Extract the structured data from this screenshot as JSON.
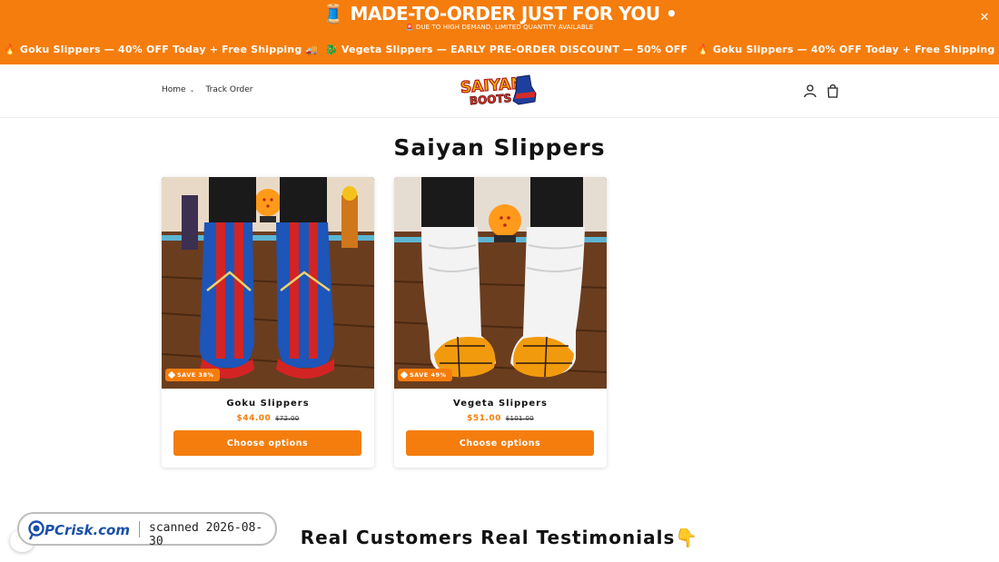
{
  "announcement": {
    "title": "🧵 MADE-TO-ORDER JUST FOR YOU •",
    "subtitle": "🚨 DUE TO HIGH DEMAND, LIMITED QUANTITY AVAILABLE",
    "close_label": "✕",
    "marquee": [
      "🔥 Goku Slippers — 40% OFF Today + Free Shipping 🚚",
      "🐉 Vegeta Slippers — EARLY PRE-ORDER DISCOUNT — 50% OFF",
      "🔥 Goku Slippers — 40% OFF Today + Free Shipping 🚚"
    ]
  },
  "header": {
    "nav": [
      {
        "label": "Home",
        "has_dropdown": true
      },
      {
        "label": "Track Order",
        "has_dropdown": false
      }
    ],
    "logo_text_top": "SAIYAN",
    "logo_text_bottom": "BOOTS",
    "icons": [
      "account-icon",
      "cart-icon"
    ]
  },
  "main": {
    "title": "Saiyan Slippers",
    "products": [
      {
        "name": "Goku Slippers",
        "badge": "SAVE 38%",
        "price": "$44.00",
        "compare_price": "$72.00",
        "button": "Choose options"
      },
      {
        "name": "Vegeta Slippers",
        "badge": "SAVE 49%",
        "price": "$51.00",
        "compare_price": "$101.00",
        "button": "Choose options"
      }
    ],
    "testimonials_heading": "Real Customers Real Testimonials👇"
  },
  "watermark": {
    "brand": "PCrisk.com",
    "scanned": "scanned 2026-08-30"
  },
  "colors": {
    "accent": "#f57d0d",
    "text": "#121212"
  }
}
